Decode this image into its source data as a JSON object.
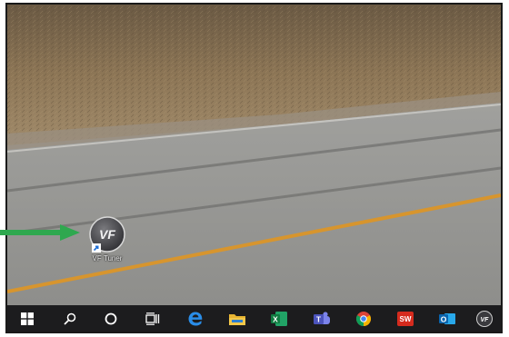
{
  "desktop": {
    "shortcuts": [
      {
        "label": "VF Tuner",
        "icon": "vf-tuner-icon",
        "logo_text": "VF"
      }
    ]
  },
  "pointer_arrow": {
    "color": "#2fa84f"
  },
  "taskbar": {
    "items": [
      {
        "name": "start-button",
        "icon": "windows-logo-icon"
      },
      {
        "name": "search-button",
        "icon": "search-icon"
      },
      {
        "name": "cortana-button",
        "icon": "cortana-circle-icon"
      },
      {
        "name": "task-view-button",
        "icon": "task-view-icon"
      },
      {
        "name": "edge-taskbar-button",
        "icon": "edge-icon"
      },
      {
        "name": "file-explorer-taskbar-button",
        "icon": "folder-icon"
      },
      {
        "name": "excel-taskbar-button",
        "icon": "excel-icon",
        "letter": "X"
      },
      {
        "name": "teams-taskbar-button",
        "icon": "teams-icon",
        "letter": "T"
      },
      {
        "name": "chrome-taskbar-button",
        "icon": "chrome-icon"
      },
      {
        "name": "solidworks-taskbar-button",
        "icon": "solidworks-icon",
        "letter": "SW"
      },
      {
        "name": "outlook-taskbar-button",
        "icon": "outlook-icon",
        "letter": "O"
      },
      {
        "name": "vf-tuner-taskbar-button",
        "icon": "vf-tuner-icon",
        "letter": "VF"
      }
    ]
  }
}
